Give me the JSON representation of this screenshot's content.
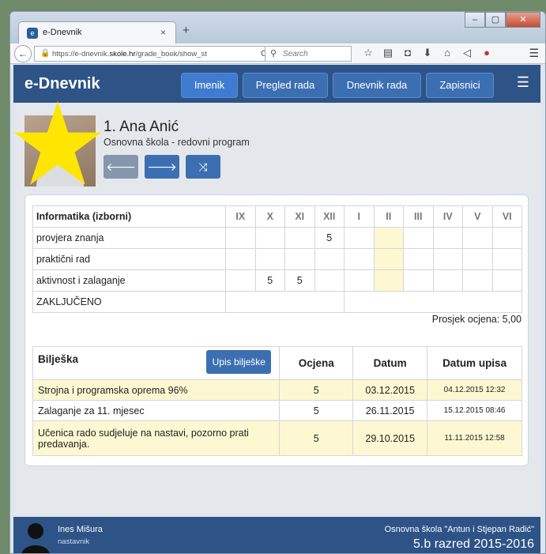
{
  "browser": {
    "tab_title": "e-Dnevnik",
    "url_prefix": "https://e-dnevnik.",
    "url_domain": "skole.hr",
    "url_path": "/grade_book/show_st",
    "search_placeholder": "Search",
    "tab_favicon": "e",
    "new_tab": "+",
    "tab_close": "×",
    "win_min": "–",
    "win_max": "▢",
    "win_close": "✕"
  },
  "app": {
    "logo": "e-Dnevnik",
    "nav": [
      "Imenik",
      "Pregled rada",
      "Dnevnik rada",
      "Zapisnici"
    ],
    "active_nav": "Imenik"
  },
  "student": {
    "name": "1. Ana Anić",
    "program": "Osnovna škola - redovni program"
  },
  "buttons": {
    "prev": "🡐",
    "next": "🡒",
    "shuffle": "⤨"
  },
  "grades": {
    "subject": "Informatika (izborni)",
    "months": [
      "IX",
      "X",
      "XI",
      "XII",
      "I",
      "II",
      "III",
      "IV",
      "V",
      "VI"
    ],
    "highlight_month": "II",
    "rows": [
      {
        "label": "provjera znanja",
        "values": [
          "",
          "",
          "",
          "5",
          "",
          "",
          "",
          "",
          "",
          ""
        ]
      },
      {
        "label": "praktični rad",
        "values": [
          "",
          "",
          "",
          "",
          "",
          "",
          "",
          "",
          "",
          ""
        ]
      },
      {
        "label": "aktivnost i zalaganje",
        "values": [
          "",
          "5",
          "5",
          "",
          "",
          "",
          "",
          "",
          "",
          ""
        ]
      }
    ],
    "final_label": "ZAKLJUČENO",
    "average": "Prosjek ocjena: 5,00"
  },
  "notes": {
    "header_note": "Bilješka",
    "add_button": "Upis bilješke",
    "header_grade": "Ocjena",
    "header_date": "Datum",
    "header_entry_date": "Datum upisa",
    "rows": [
      {
        "note": "Strojna i programska oprema 96%",
        "grade": "5",
        "date": "03.12.2015",
        "entry": "04.12.2015 12:32",
        "highlight": true
      },
      {
        "note": "Zalaganje za 11. mjesec",
        "grade": "5",
        "date": "26.11.2015",
        "entry": "15.12.2015 08:46",
        "highlight": false
      },
      {
        "note": "Učenica rado sudjeluje na nastavi, pozorno prati predavanja.",
        "grade": "5",
        "date": "29.10.2015",
        "entry": "11.11.2015 12:58",
        "highlight": true
      }
    ]
  },
  "footer": {
    "teacher": "Ines Mišura",
    "role": "nastavnik",
    "school": "Osnovna škola \"Antun i Stjepan Radić\"",
    "class": "5.b razred 2015-2016"
  },
  "colors": {
    "header_bg": "#2d5387",
    "button_bg": "#3c6fb2",
    "highlight": "#fdf8d2",
    "nav_button_grey": "#8597ad",
    "nav_button_blue": "#3c6fb2",
    "star": "#ffe600"
  }
}
